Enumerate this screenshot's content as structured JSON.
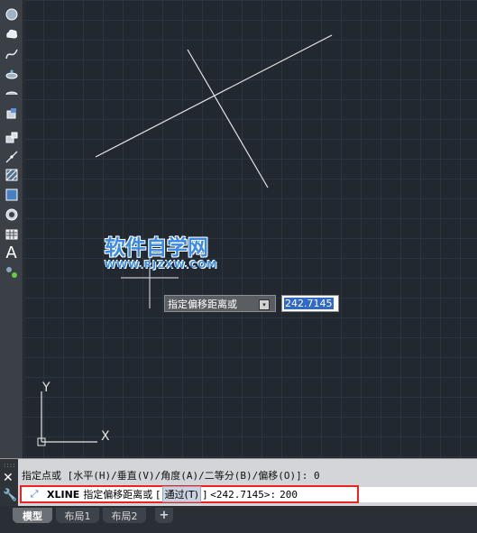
{
  "toolbar": {
    "tools": [
      "circle-icon",
      "revision-cloud-icon",
      "spline-icon",
      "ellipse-icon",
      "ellipse-arc-icon",
      "insert-block-icon",
      "make-block-icon",
      "point-icon",
      "hatch-icon",
      "gradient-icon",
      "region-icon",
      "table-icon",
      "multiline-text-icon",
      "add-selected-icon"
    ],
    "text_tool_glyph": "A"
  },
  "watermark": {
    "main": "软件自学网",
    "sub": "WWW.RJZXW.COM"
  },
  "dynamic_input": {
    "prompt": "指定偏移距离或",
    "dropdown_glyph": "▾",
    "value": "242.7145"
  },
  "ucs": {
    "x_label": "X",
    "y_label": "Y"
  },
  "command": {
    "close_glyph": "✕",
    "wrench_glyph": "🔧",
    "history": "指定点或 [水平(H)/垂直(V)/角度(A)/二等分(B)/偏移(O)]: 0",
    "icon_glyph": "⤢",
    "name": "XLINE",
    "prompt": "指定偏移距离或",
    "bracket_open": "[",
    "option": "通过(T)",
    "bracket_close": "]",
    "default_value": "<242.7145>:",
    "input_value": "200"
  },
  "tabs": {
    "model": "模型",
    "layout1": "布局1",
    "layout2": "布局2",
    "add": "+"
  }
}
